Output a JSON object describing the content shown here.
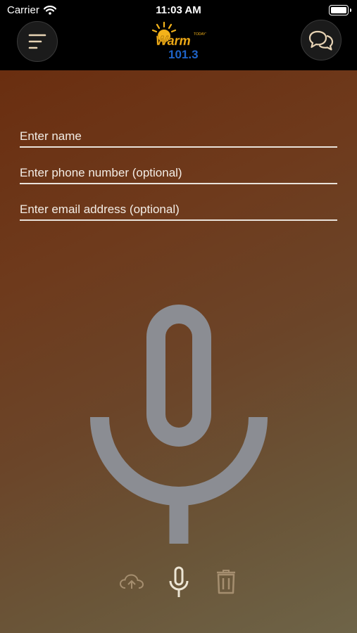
{
  "status_bar": {
    "carrier": "Carrier",
    "time": "11:03 AM"
  },
  "header": {
    "logo": {
      "brand": "Warm",
      "frequency": "101.3",
      "small_text": "TODAY'S"
    }
  },
  "form": {
    "name_placeholder": "Enter name",
    "phone_placeholder": "Enter phone number (optional)",
    "email_placeholder": "Enter email address (optional)"
  },
  "icons": {
    "menu": "menu-icon",
    "chat": "chat-icon",
    "record": "microphone-icon",
    "upload": "cloud-upload-icon",
    "delete": "trash-icon"
  },
  "colors": {
    "accent": "#e7d3b4",
    "logo_yellow": "#f3b21a",
    "logo_blue": "#1e63c8",
    "mic_gray": "#8b8d93",
    "tool_disabled": "#a58e6f"
  }
}
